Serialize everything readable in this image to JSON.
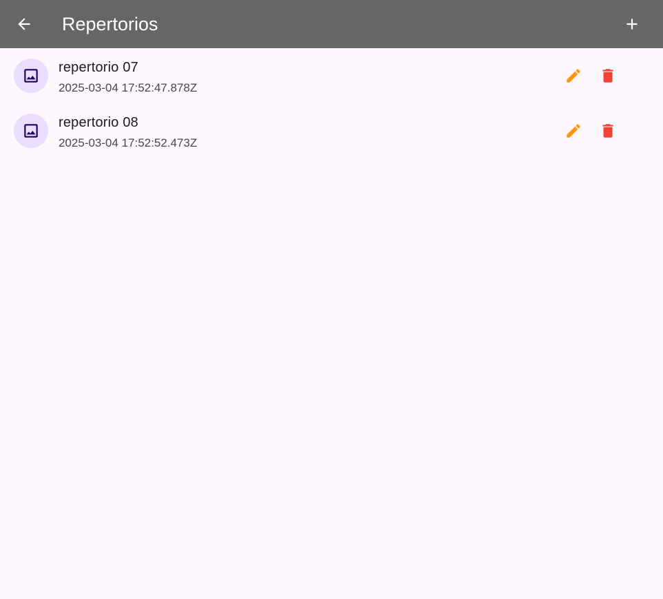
{
  "appbar": {
    "title": "Repertorios",
    "back_icon": "arrow-back-icon",
    "add_icon": "add-icon",
    "background": "#666666"
  },
  "items": [
    {
      "title": "repertorio 07",
      "subtitle": "2025-03-04 17:52:47.878Z",
      "leading_icon": "image-icon",
      "edit_icon": "edit-icon",
      "delete_icon": "delete-icon"
    },
    {
      "title": "repertorio 08",
      "subtitle": "2025-03-04 17:52:52.473Z",
      "leading_icon": "image-icon",
      "edit_icon": "edit-icon",
      "delete_icon": "delete-icon"
    }
  ],
  "colors": {
    "edit": "#ff9800",
    "delete": "#f44336",
    "avatar_bg": "#eaddff",
    "avatar_icon": "#21005d",
    "page_bg": "#fdf7fe"
  }
}
